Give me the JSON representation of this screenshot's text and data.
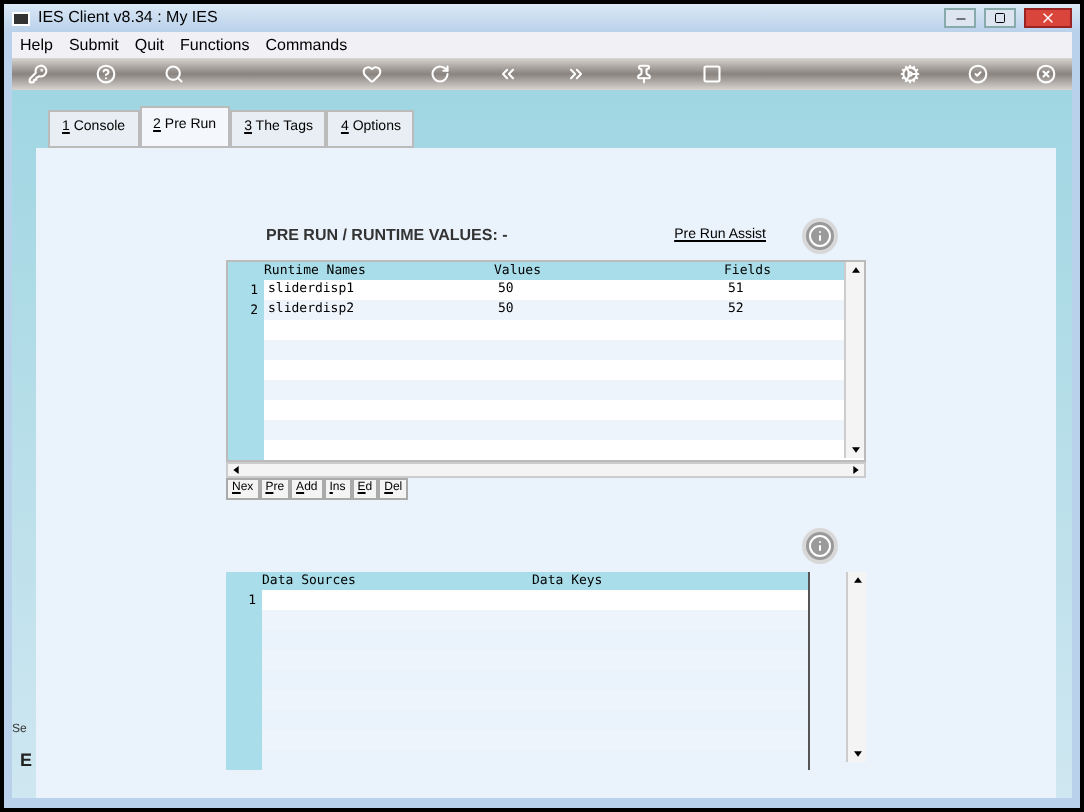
{
  "window": {
    "title": "IES Client v8.34 : My IES"
  },
  "menu": [
    "Help",
    "Submit",
    "Quit",
    "Functions",
    "Commands"
  ],
  "tabs": [
    {
      "key": "1",
      "label": " Console",
      "selected": false
    },
    {
      "key": "2",
      "label": " Pre Run",
      "selected": true
    },
    {
      "key": "3",
      "label": " The Tags",
      "selected": false
    },
    {
      "key": "4",
      "label": " Options",
      "selected": false
    }
  ],
  "left_strip": {
    "label_1": "Se",
    "label_2": "E"
  },
  "runtime": {
    "heading": "PRE RUN / RUNTIME VALUES: -",
    "assist_link": "Pre Run Assist",
    "columns": [
      "Runtime Names",
      "Values",
      "Fields"
    ],
    "rows": [
      {
        "num": "1",
        "cells": [
          "sliderdisp1",
          "50",
          "51"
        ]
      },
      {
        "num": "2",
        "cells": [
          "sliderdisp2",
          "50",
          "52"
        ]
      }
    ],
    "buttons": [
      {
        "key": "N",
        "rest": "ex"
      },
      {
        "key": "P",
        "rest": "re"
      },
      {
        "key": "A",
        "rest": "dd"
      },
      {
        "key": "I",
        "rest": "ns"
      },
      {
        "key": "E",
        "rest": "d"
      },
      {
        "key": "D",
        "rest": "el"
      }
    ]
  },
  "sources": {
    "columns": [
      "Data Sources",
      "Data Keys"
    ],
    "rows": [
      {
        "num": "1"
      }
    ]
  }
}
